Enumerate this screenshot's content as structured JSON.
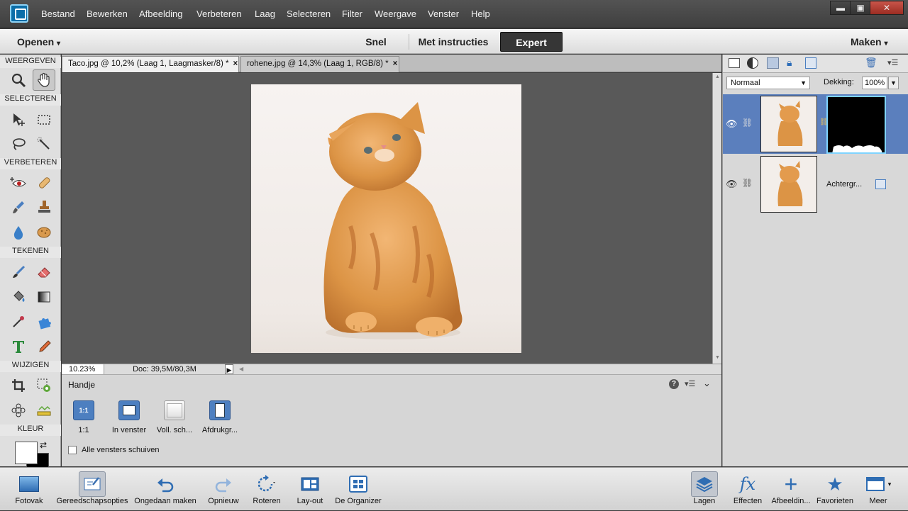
{
  "menu": [
    "Bestand",
    "Bewerken",
    "Afbeelding",
    "Verbeteren",
    "Laag",
    "Selecteren",
    "Filter",
    "Weergave",
    "Venster",
    "Help"
  ],
  "window_controls": {
    "minimize": "▬",
    "restore": "▣",
    "close": "✕"
  },
  "modebar": {
    "open": "Openen",
    "quick": "Snel",
    "guided": "Met instructies",
    "expert": "Expert",
    "create": "Maken"
  },
  "toolbox": {
    "sections": [
      "WEERGEVEN",
      "SELECTEREN",
      "VERBETEREN",
      "TEKENEN",
      "WIJZIGEN",
      "KLEUR"
    ]
  },
  "tabs": [
    {
      "label": "Taco.jpg @ 10,2% (Laag 1, Laagmasker/8) *",
      "close": "×"
    },
    {
      "label": "rohene.jpg @ 14,3% (Laag 1, RGB/8) *",
      "close": "×"
    }
  ],
  "status": {
    "zoom": "10.23%",
    "doc": "Doc: 39,5M/80,3M"
  },
  "options": {
    "tool_name": "Handje",
    "buttons": [
      "1:1",
      "In venster",
      "Voll. sch...",
      "Afdrukgr..."
    ],
    "button_icon_text": "1:1",
    "checkbox_label": "Alle vensters schuiven",
    "checkbox_checked": false
  },
  "layers": {
    "blend_mode": "Normaal",
    "opacity_label": "Dekking:",
    "opacity_value": "100%",
    "items": [
      {
        "name": "",
        "selected": true,
        "has_mask": true
      },
      {
        "name": "Achtergr...",
        "selected": false,
        "has_mask": false
      }
    ]
  },
  "bottombar": {
    "left": [
      "Fotovak",
      "Gereedschapsopties",
      "Ongedaan maken",
      "Opnieuw",
      "Roteren",
      "Lay-out",
      "De Organizer"
    ],
    "right": [
      "Lagen",
      "Effecten",
      "Afbeeldin...",
      "Favorieten",
      "Meer"
    ]
  },
  "colors": {
    "accent_selected": "#5b7fbd",
    "canvas": "#595959",
    "foreground": "#ffffff",
    "background": "#000000"
  }
}
